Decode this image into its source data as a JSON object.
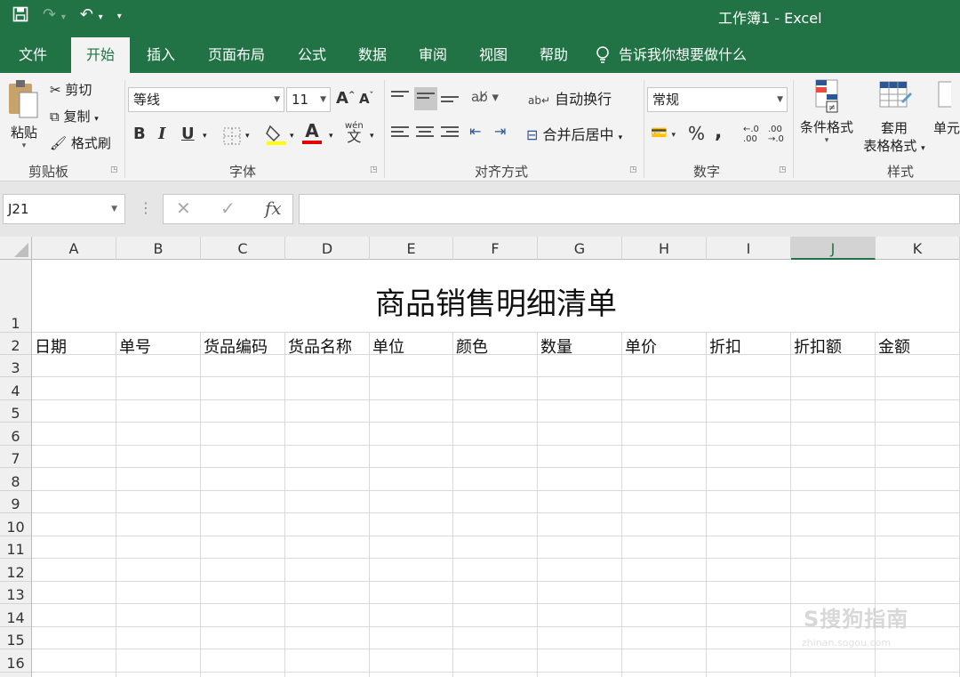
{
  "titlebar": {
    "title": "工作簿1  -  Excel",
    "qat": {
      "save_icon": "save-icon",
      "redo_icon": "redo-icon",
      "undo_icon": "undo-icon",
      "customize_icon": "customize-icon"
    }
  },
  "tabs": [
    "文件",
    "开始",
    "插入",
    "页面布局",
    "公式",
    "数据",
    "审阅",
    "视图",
    "帮助"
  ],
  "active_tab": "开始",
  "tell_me": "告诉我你想要做什么",
  "clipboard": {
    "paste": "粘贴",
    "cut": "剪切",
    "copy": "复制",
    "format_painter": "格式刷",
    "group": "剪贴板"
  },
  "font": {
    "name": "等线",
    "size": "11",
    "group": "字体",
    "bold": "B",
    "italic": "I",
    "underline": "U",
    "wen": "wén",
    "wen_char": "文",
    "font_color": "A",
    "grow": "A",
    "shrink": "A"
  },
  "alignment": {
    "wrap_text": "自动换行",
    "merge_center": "合并后居中",
    "group": "对齐方式"
  },
  "number": {
    "format": "常规",
    "percent": "%",
    "comma": ",",
    "inc_dec": ".00",
    "group": "数字"
  },
  "styles": {
    "conditional": "条件格式",
    "format_table_1": "套用",
    "format_table_2": "表格格式",
    "cell_styles": "单元",
    "group": "样式"
  },
  "formula_bar": {
    "name_box": "J21",
    "cancel": "✕",
    "enter": "✓",
    "fx": "fx",
    "value": ""
  },
  "columns": [
    "A",
    "B",
    "C",
    "D",
    "E",
    "F",
    "G",
    "H",
    "I",
    "J",
    "K"
  ],
  "selected_column": "J",
  "rows": [
    "1",
    "2",
    "3",
    "4",
    "5",
    "6",
    "7",
    "8",
    "9",
    "10",
    "11",
    "12",
    "13",
    "14",
    "15",
    "16"
  ],
  "sheet": {
    "title": "商品销售明细清单",
    "headers": [
      "日期",
      "单号",
      "货品编码",
      "货品名称",
      "单位",
      "颜色",
      "数量",
      "单价",
      "折扣",
      "折扣额",
      "金额"
    ]
  },
  "watermark": {
    "text": "S搜狗指南",
    "sub": "zhinan.sogou.com"
  },
  "colors": {
    "brand": "#217346",
    "ribbon_bg": "#f3f3f3",
    "grid_line": "#d9d9d9",
    "header_bg": "#f0f0f0"
  }
}
